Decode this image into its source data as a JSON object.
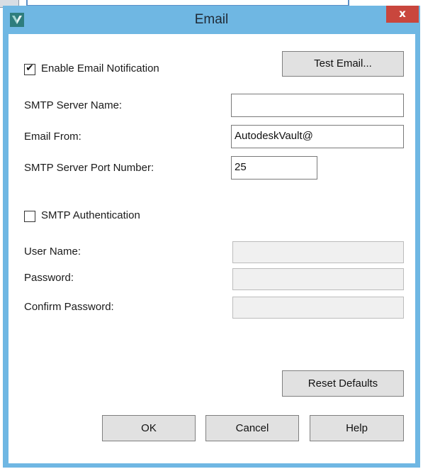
{
  "window": {
    "title": "Email",
    "close_glyph": "x",
    "icon": "autodesk-vault-icon"
  },
  "notification": {
    "enable_label": "Enable Email Notification",
    "enable_checked": true,
    "test_button": "Test Email..."
  },
  "fields": {
    "server_name_label": "SMTP Server Name:",
    "server_name_value": "",
    "email_from_label": "Email From:",
    "email_from_value": "AutodeskVault@",
    "port_label": "SMTP Server Port Number:",
    "port_value": "25"
  },
  "auth": {
    "label": "SMTP Authentication",
    "checked": false,
    "user_label": "User Name:",
    "user_value": "",
    "password_label": "Password:",
    "password_value": "",
    "confirm_label": "Confirm Password:",
    "confirm_value": ""
  },
  "buttons": {
    "reset": "Reset Defaults",
    "ok": "OK",
    "cancel": "Cancel",
    "help": "Help"
  },
  "colors": {
    "title_bar": "#6fb7e3",
    "close_button": "#c9463d",
    "button_face": "#e1e1e1",
    "disabled_field": "#f0f0f0"
  }
}
